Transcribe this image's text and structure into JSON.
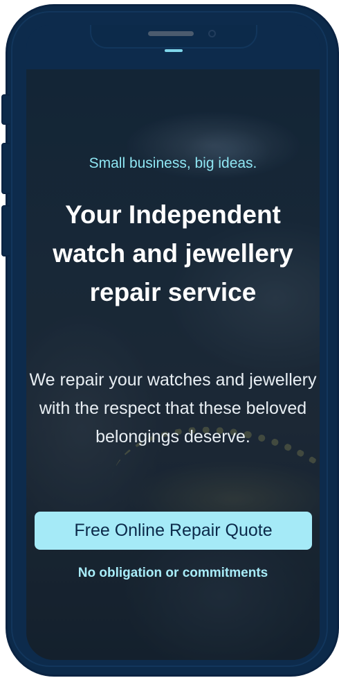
{
  "hero": {
    "tagline": "Small business, big ideas.",
    "headline": "Your Independent watch and jewellery repair service",
    "description": "We repair your watches and jewellery with the respect that these beloved belongings deserve.",
    "cta_label": "Free Online Repair Quote",
    "note": "No obligation or commitments"
  },
  "colors": {
    "frame": "#0c2a4a",
    "accent": "#a5eaf7",
    "tagline": "#8fe6f3"
  },
  "icons": {
    "menu": "menu-bar-icon"
  }
}
